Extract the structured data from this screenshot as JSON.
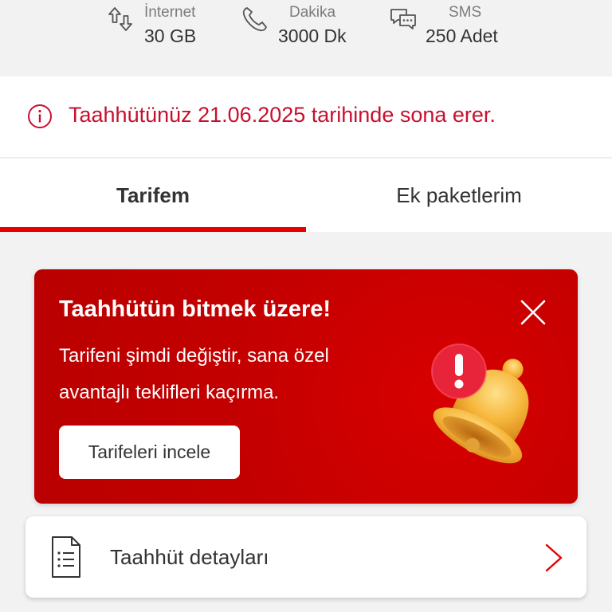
{
  "stats": [
    {
      "label": "İnternet",
      "value": "30 GB",
      "icon": "internet-arrows-icon"
    },
    {
      "label": "Dakika",
      "value": "3000 Dk",
      "icon": "phone-icon"
    },
    {
      "label": "SMS",
      "value": "250 Adet",
      "icon": "chat-bubbles-icon"
    }
  ],
  "notice": {
    "text": "Taahhütünüz 21.06.2025 tarihinde sona erer.",
    "icon": "info-icon"
  },
  "tabs": [
    {
      "label": "Tarifem",
      "active": true
    },
    {
      "label": "Ek paketlerim",
      "active": false
    }
  ],
  "promo": {
    "title": "Taahhütün bitmek üzere!",
    "body_line1": "Tarifeni şimdi değiştir, sana özel",
    "body_line2": "avantajlı teklifleri kaçırma.",
    "button": "Tarifeleri incele"
  },
  "detail": {
    "label": "Taahhüt detayları",
    "icon": "document-icon"
  },
  "colors": {
    "brand": "#e60000",
    "alert_text": "#c8102e",
    "promo_bg": "#c40000"
  }
}
